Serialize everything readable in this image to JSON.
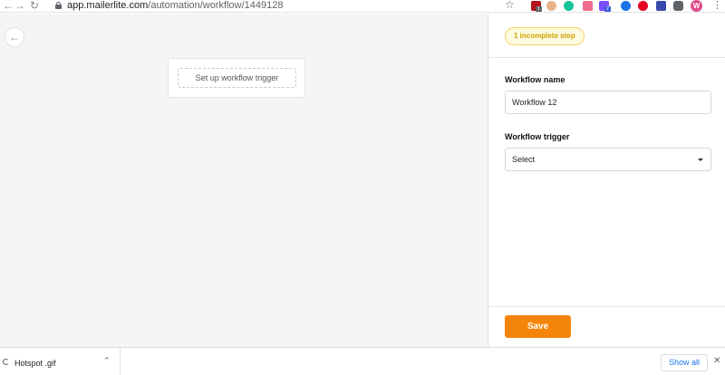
{
  "browser": {
    "url_host": "app.mailerlite.com",
    "url_path": "/automation/workflow/1449128",
    "extension_badges": [
      "1",
      "2"
    ],
    "profile_initial": "W"
  },
  "icons": {
    "back": "arrow-left-icon",
    "forward": "arrow-right-icon",
    "reload": "reload-icon",
    "lock": "lock-icon",
    "star": "star-icon",
    "menu": "kebab-menu-icon",
    "canvas_back": "arrow-left-icon",
    "select_caret": "caret-down-icon",
    "download_file": "file-icon",
    "chevron_up": "chevron-up-icon",
    "close": "close-icon"
  },
  "colors": {
    "save": "#f5850a",
    "badge_border": "#f5d46b",
    "badge_text": "#c9a100",
    "show_all": "#1a73e8"
  },
  "canvas": {
    "trigger_button_label": "Set up workflow trigger"
  },
  "panel": {
    "status_badge": "1 incomplete step",
    "workflow_name_label": "Workflow name",
    "workflow_name_value": "Workflow 12",
    "workflow_trigger_label": "Workflow trigger",
    "workflow_trigger_value": "Select",
    "save_label": "Save"
  },
  "downloads": {
    "file_name": "Hotspot .gif",
    "show_all_label": "Show all"
  }
}
